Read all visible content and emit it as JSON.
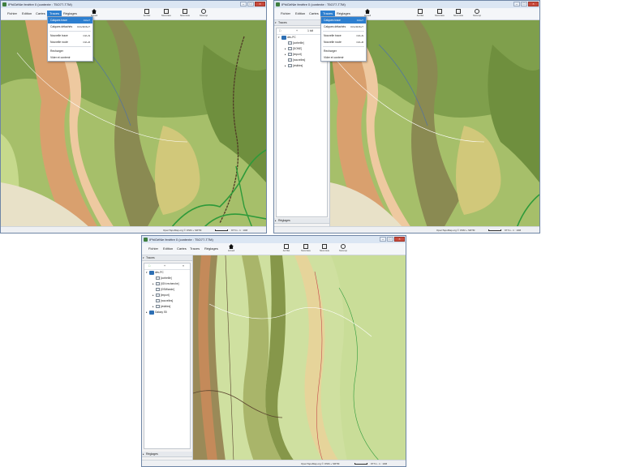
{
  "window_title": "IPhiGéNie fenêtre 0 (contexte : T5O77-T7M)",
  "menu": {
    "fichier": "Fichier",
    "edition": "Edition",
    "cartes": "Cartes",
    "traces": "Traces",
    "reglages": "Réglages"
  },
  "toolbar": {
    "accueil": "Accueil",
    "aufiler": "Au Filet",
    "nouv_trace": "Nouv.trace",
    "nouv_route": "Nouv.route",
    "nouv_rep": "Nouv.rep"
  },
  "traces_menu": [
    {
      "label": "Calques trace",
      "shortcut": "Ctrl+T"
    },
    {
      "label": "Calques détachés",
      "shortcut": "Ctrl+Shift+T"
    },
    {
      "label": "Nouvelle trace",
      "shortcut": "Ctrl+N"
    },
    {
      "label": "Nouvelle route",
      "shortcut": "Ctrl+R"
    },
    {
      "label": "Recharger",
      "shortcut": ""
    },
    {
      "label": "Vider et contenir",
      "shortcut": ""
    }
  ],
  "panel": {
    "header": "Traces",
    "add_label": "+",
    "all_label": "1 tdt",
    "footer": "Réglages"
  },
  "tree_w2": [
    "dev-PC",
    "[corbeille]",
    "[DONE]",
    "[import]",
    "[nouvelles]",
    "[visibles]"
  ],
  "tree_w3": [
    "dev-PC",
    "[corbeille]",
    "[IGN recherche]",
    "[OSMlande]",
    "[import]",
    "[nouvelles]",
    "[visibles]",
    "Galaxy S5"
  ],
  "status": {
    "attribution": "OpenTopoMap.org © OSM + SRTM",
    "scale": "977m - 1 : 10M"
  },
  "colors": {
    "menu_highlight": "#2d7fd0",
    "track": "#2e9a3a",
    "route": "#5c4630"
  }
}
